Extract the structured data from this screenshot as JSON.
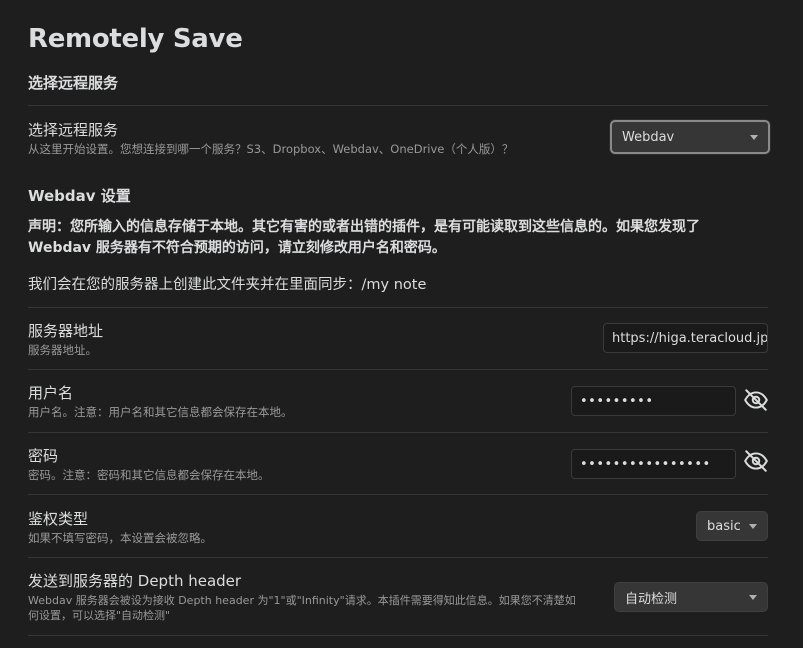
{
  "title": "Remotely Save",
  "section_remote": "选择远程服务",
  "remote_service": {
    "name": "选择远程服务",
    "desc": "从这里开始设置。您想连接到哪一个服务？S3、Dropbox、Webdav、OneDrive（个人版）？",
    "value": "Webdav"
  },
  "webdav_heading": "Webdav 设置",
  "warning": "声明：您所输入的信息存储于本地。其它有害的或者出错的插件，是有可能读取到这些信息的。如果您发现了 Webdav 服务器有不符合预期的访问，请立刻修改用户名和密码。",
  "folder_note": "我们会在您的服务器上创建此文件夹并在里面同步：/my note",
  "server_address": {
    "name": "服务器地址",
    "desc": "服务器地址。",
    "value": "https://higa.teracloud.jp/d"
  },
  "username": {
    "name": "用户名",
    "desc": "用户名。注意：用户名和其它信息都会保存在本地。",
    "value": "•••••••••",
    "toggle_icon": "eye-off-icon"
  },
  "password": {
    "name": "密码",
    "desc": "密码。注意：密码和其它信息都会保存在本地。",
    "value": "••••••••••••••••",
    "toggle_icon": "eye-off-icon"
  },
  "auth_type": {
    "name": "鉴权类型",
    "desc": "如果不填写密码，本设置会被忽略。",
    "value": "basic"
  },
  "depth_header": {
    "name": "发送到服务器的 Depth header",
    "desc_line1": "Webdav 服务器会被设为接收 Depth header 为\"1\"或\"Infinity\"请求。本插件需要得知此信息。如果您不清楚如",
    "desc_line2": "何设置，可以选择\"自动检测\"",
    "value": "自动检测"
  },
  "colors": {
    "background": "#1e1e1e",
    "text": "#dcddde",
    "muted": "#999999",
    "control": "#363636",
    "divider": "#363636"
  }
}
